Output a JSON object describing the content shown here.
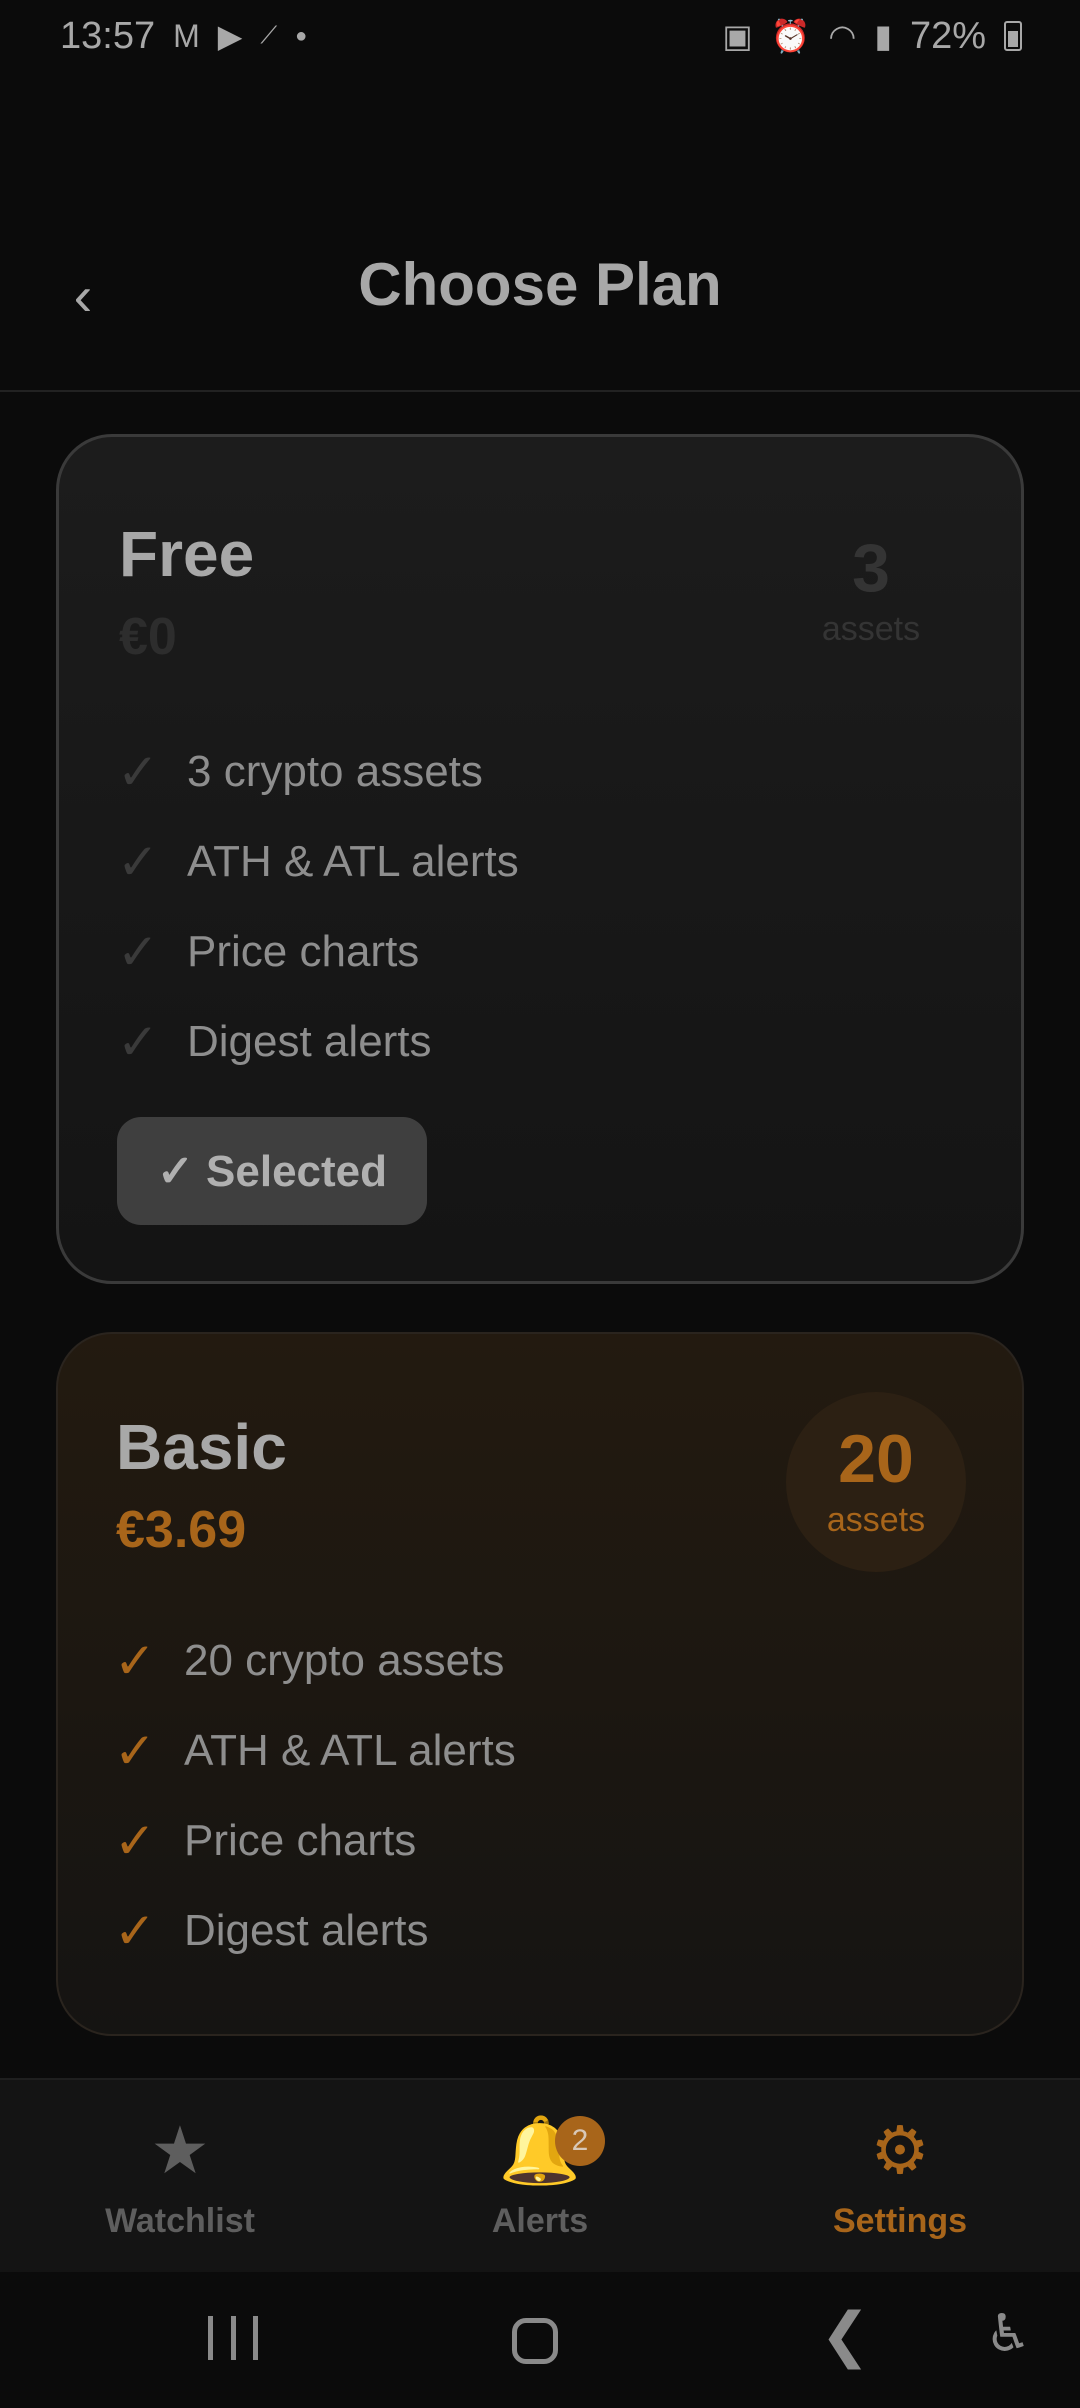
{
  "status_bar": {
    "time": "13:57",
    "battery": "72%",
    "left_icons": [
      "gmail-icon",
      "youtube-icon",
      "trend-icon",
      "dot-icon"
    ],
    "right_icons": [
      "battery-saver-icon",
      "alarm-icon",
      "wifi-icon",
      "signal-icon",
      "battery-icon"
    ]
  },
  "header": {
    "back_label": "‹",
    "title": "Choose Plan"
  },
  "plans": [
    {
      "name": "Free",
      "price": "€0",
      "assets_count": "3",
      "assets_unit": "assets",
      "features": [
        "3 crypto assets",
        "ATH & ATL alerts",
        "Price charts",
        "Digest alerts"
      ],
      "check_glyph": "✓",
      "button_label": "✓ Selected"
    },
    {
      "name": "Basic",
      "price": "€3.69",
      "assets_count": "20",
      "assets_unit": "assets",
      "features": [
        "20 crypto assets",
        "ATH & ATL alerts",
        "Price charts",
        "Digest alerts"
      ],
      "check_glyph": "✓"
    }
  ],
  "bottom_nav": {
    "items": [
      {
        "label": "Watchlist",
        "icon": "★",
        "active": false
      },
      {
        "label": "Alerts",
        "icon": "🔔",
        "badge": "2",
        "active": false
      },
      {
        "label": "Settings",
        "icon": "⚙",
        "active": true
      }
    ]
  },
  "colors": {
    "accent": "#a8651a",
    "background": "#0b0b0b",
    "card_free": "#1c1c1c",
    "card_basic": "#231a10"
  }
}
